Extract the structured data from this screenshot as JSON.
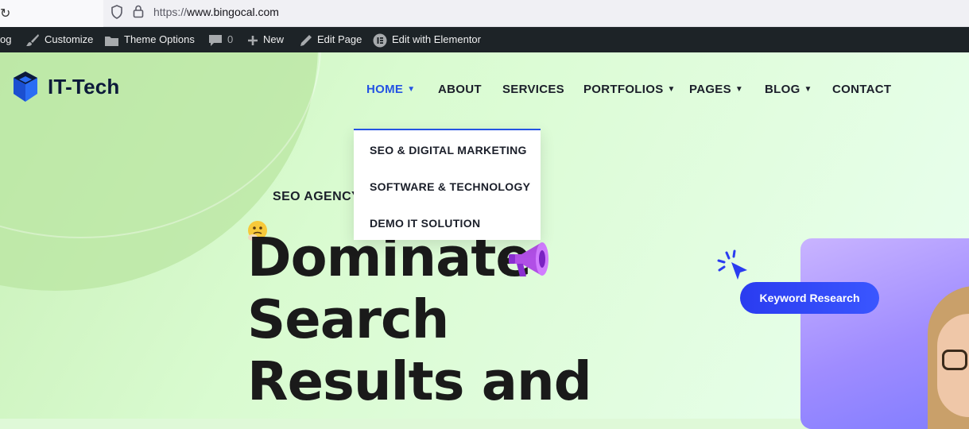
{
  "browser": {
    "url_protocol": "https://",
    "url_host": "www.bingocal.com"
  },
  "adminbar": {
    "items": [
      {
        "label": "og"
      },
      {
        "label": "Customize"
      },
      {
        "label": "Theme Options"
      },
      {
        "label": "0"
      },
      {
        "label": "New"
      },
      {
        "label": "Edit Page"
      },
      {
        "label": "Edit with Elementor"
      }
    ]
  },
  "site": {
    "logo_text": "IT-Tech"
  },
  "nav": {
    "items": [
      {
        "label": "HOME",
        "has_dropdown": true,
        "active": true
      },
      {
        "label": "ABOUT",
        "has_dropdown": false
      },
      {
        "label": "SERVICES",
        "has_dropdown": false
      },
      {
        "label": "PORTFOLIOS",
        "has_dropdown": true
      },
      {
        "label": "PAGES",
        "has_dropdown": true
      },
      {
        "label": "BLOG",
        "has_dropdown": true
      },
      {
        "label": "CONTACT",
        "has_dropdown": false
      }
    ],
    "chevron": "⌄"
  },
  "dropdown": {
    "items": [
      {
        "label": "SEO & DIGITAL MARKETING"
      },
      {
        "label": "SOFTWARE & TECHNOLOGY"
      },
      {
        "label": "DEMO IT SOLUTION"
      }
    ]
  },
  "hero": {
    "subtitle": "SEO AGENCY",
    "headline_lines": [
      "Dominate",
      "Search",
      "Results and"
    ],
    "keyword_button": "Keyword Research"
  },
  "colors": {
    "accent": "#2453e3",
    "adminbar_bg": "#1d2327",
    "button_bg": "#2a3cf0"
  }
}
